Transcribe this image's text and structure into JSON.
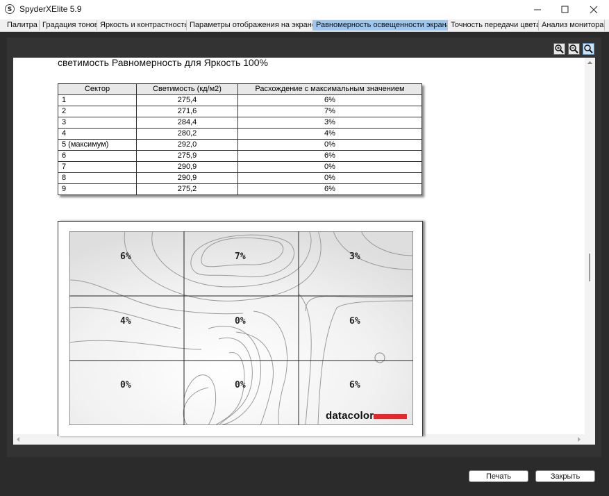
{
  "window": {
    "title": "SpyderXElite 5.9"
  },
  "tabs": [
    {
      "label": "Палитра"
    },
    {
      "label": "Градация тонов"
    },
    {
      "label": "Яркость и контрастность"
    },
    {
      "label": "Параметры отображения на экране"
    },
    {
      "label": "Равномерность освещенности экрана",
      "active": true
    },
    {
      "label": "Точность передачи цвета"
    },
    {
      "label": "Анализ монитора"
    }
  ],
  "zoom_controls": [
    "zoom-in-icon",
    "zoom-out-icon",
    "zoom-fit-icon"
  ],
  "report": {
    "title": "светимость Равномерность для Яркость 100%",
    "table": {
      "headers": [
        "Сектор",
        "Светимость (кд/м2)",
        "Расхождение с максимальным значением"
      ],
      "rows": [
        [
          "1",
          "275,4",
          "6%"
        ],
        [
          "2",
          "271,6",
          "7%"
        ],
        [
          "3",
          "284,4",
          "3%"
        ],
        [
          "4",
          "280,2",
          "4%"
        ],
        [
          "5 (максимум)",
          "292,0",
          "0%"
        ],
        [
          "6",
          "275,9",
          "6%"
        ],
        [
          "7",
          "290,9",
          "0%"
        ],
        [
          "8",
          "290,9",
          "0%"
        ],
        [
          "9",
          "275,2",
          "6%"
        ]
      ]
    },
    "map_labels": [
      "6%",
      "7%",
      "3%",
      "4%",
      "0%",
      "6%",
      "0%",
      "0%",
      "6%"
    ],
    "logo_text": "datacolor",
    "logo_color": "#e8262b"
  },
  "buttons": {
    "print": "Печать",
    "close": "Закрыть"
  }
}
